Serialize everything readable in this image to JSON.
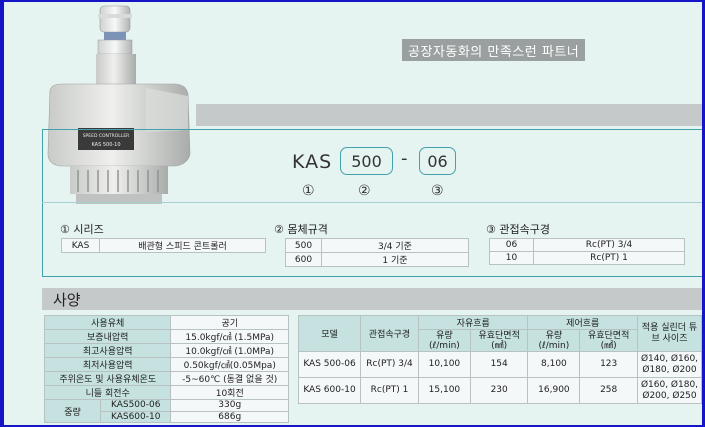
{
  "slogan": "공장자동화의 만족스런 파트너",
  "product": {
    "label_line1": "SPEED CONTROLLER",
    "label_line2": "KAS 500-10"
  },
  "code": {
    "prefix": "KAS",
    "box1": "500",
    "dash": "-",
    "box2": "06",
    "markers": [
      "①",
      "②",
      "③"
    ]
  },
  "groups": {
    "series": {
      "title": "① 시리즈",
      "rows": [
        [
          "KAS",
          "배관형 스피드 콘트롤러"
        ]
      ]
    },
    "body": {
      "title": "② 몸체규격",
      "rows": [
        [
          "500",
          "3/4 기준"
        ],
        [
          "600",
          "1 기준"
        ]
      ]
    },
    "port": {
      "title": "③ 관접속구경",
      "rows": [
        [
          "06",
          "Rc(PT) 3/4"
        ],
        [
          "10",
          "Rc(PT) 1"
        ]
      ]
    }
  },
  "spec_title": "사양",
  "spec_left": {
    "rows": [
      [
        "사용유체",
        "공기"
      ],
      [
        "보증내압력",
        "15.0kgf/㎠ (1.5MPa)"
      ],
      [
        "최고사용압력",
        "10.0kgf/㎠ (1.0MPa)"
      ],
      [
        "최저사용압력",
        "0.50kgf/㎠(0.05Mpa)"
      ],
      [
        "주위온도 및 사용유체온도",
        "-5~60℃ (동결 없을 것)"
      ],
      [
        "니들 회전수",
        "10회전"
      ]
    ],
    "weight_label": "중량",
    "weights": [
      [
        "KAS500-06",
        "330g"
      ],
      [
        "KAS600-10",
        "686g"
      ]
    ]
  },
  "spec_right": {
    "headers": {
      "model": "모델",
      "port": "관접속구경",
      "free_flow": "자유흐름",
      "ctrl_flow": "제어흐름",
      "cylinder": "적용 실린더 튜브 사이즈",
      "flow": "유량 (ℓ/min)",
      "area": "유효단면적 (㎟)"
    },
    "rows": [
      {
        "model": "KAS 500-06",
        "port": "Rc(PT) 3/4",
        "free_flow": "10,100",
        "free_area": "154",
        "ctrl_flow": "8,100",
        "ctrl_area": "123",
        "cyl1": "Ø140, Ø160,",
        "cyl2": "Ø180, Ø200"
      },
      {
        "model": "KAS 600-10",
        "port": "Rc(PT) 1",
        "free_flow": "15,100",
        "free_area": "230",
        "ctrl_flow": "16,900",
        "ctrl_area": "258",
        "cyl1": "Ø160, Ø180,",
        "cyl2": "Ø200, Ø250"
      }
    ]
  }
}
